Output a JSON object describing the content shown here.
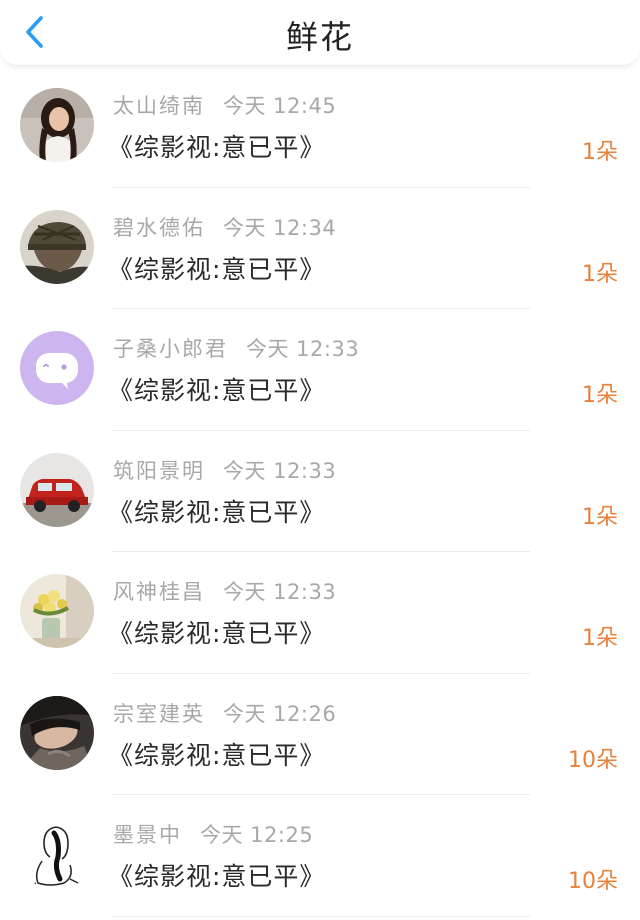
{
  "header": {
    "title": "鲜花",
    "back_icon": "chevron-left-icon",
    "accent": "#2b9cf2"
  },
  "colors": {
    "count": "#e8813a",
    "meta": "#a8a8a8",
    "divider": "#ececec"
  },
  "records": [
    {
      "name": "太山绮南",
      "time": "今天 12:45",
      "book": "《综影视:意已平》",
      "count": "1朵",
      "avatar": "woman-portrait-avatar"
    },
    {
      "name": "碧水德佑",
      "time": "今天 12:34",
      "book": "《综影视:意已平》",
      "count": "1朵",
      "avatar": "soldier-helmet-avatar"
    },
    {
      "name": "子桑小郎君",
      "time": "今天 12:33",
      "book": "《综影视:意已平》",
      "count": "1朵",
      "avatar": "chat-bubble-avatar"
    },
    {
      "name": "筑阳景明",
      "time": "今天 12:33",
      "book": "《综影视:意已平》",
      "count": "1朵",
      "avatar": "red-toy-car-avatar"
    },
    {
      "name": "风神桂昌",
      "time": "今天 12:33",
      "book": "《综影视:意已平》",
      "count": "1朵",
      "avatar": "flower-vase-avatar"
    },
    {
      "name": "宗室建英",
      "time": "今天 12:26",
      "book": "《综影视:意已平》",
      "count": "10朵",
      "avatar": "sleeping-person-avatar"
    },
    {
      "name": "墨景中",
      "time": "今天 12:25",
      "book": "《综影视:意已平》",
      "count": "10朵",
      "avatar": "sketch-figure-avatar"
    }
  ]
}
